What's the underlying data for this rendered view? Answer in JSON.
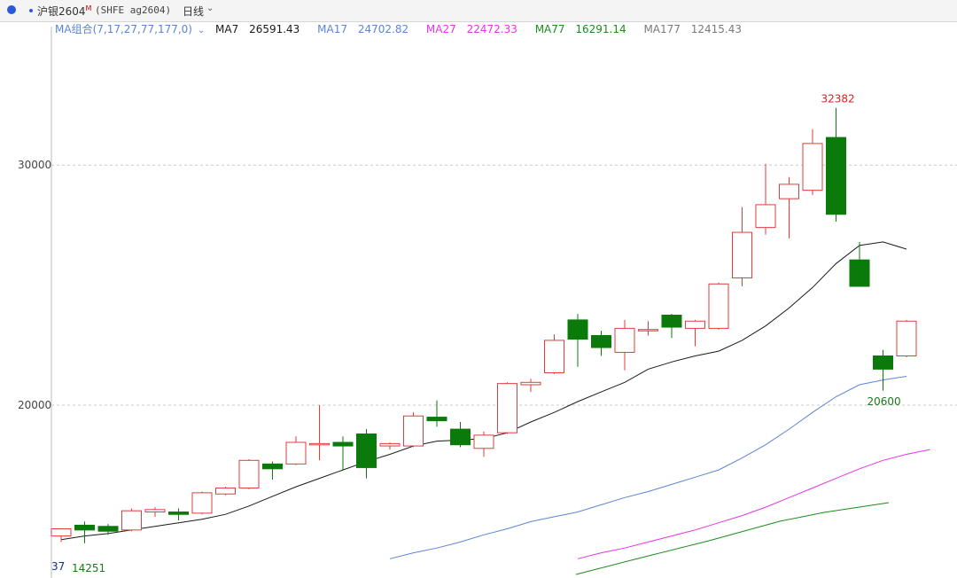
{
  "header": {
    "instrument_name": "沪银2604",
    "marker": "M",
    "contract": "(SHFE ag2604)",
    "period": "日线",
    "dropdown_icon": "chevron-down-icon"
  },
  "ma_legend": {
    "combo_label": "MA组合(7,17,27,77,177,0)",
    "items": [
      {
        "label": "MA7",
        "value": "26591.43",
        "color": "#1a1a1a"
      },
      {
        "label": "MA17",
        "value": "24702.82",
        "color": "#5b84d6"
      },
      {
        "label": "MA27",
        "value": "22472.33",
        "color": "#e633e6"
      },
      {
        "label": "MA77",
        "value": "16291.14",
        "color": "#1c8c1c"
      },
      {
        "label": "MA177",
        "value": "12415.43",
        "color": "#7a7a7a"
      }
    ]
  },
  "colors": {
    "up": "#e23b3b",
    "down": "#0a7a0a",
    "grid": "#c8c8c8"
  },
  "annotations": {
    "high_label": "32382",
    "low_label": "20600",
    "bottom_left_label": "14251",
    "bottom_left_partial": "37"
  },
  "chart_data": {
    "type": "candlestick",
    "title": "",
    "ylim": [
      12800,
      35400
    ],
    "y_ticks": [
      20000,
      30000
    ],
    "y_tick_labels": [
      "20000",
      "30000"
    ],
    "grid": true,
    "candles": [
      {
        "o": 14550,
        "h": 14700,
        "l": 14300,
        "c": 14850
      },
      {
        "o": 15000,
        "h": 15150,
        "l": 14251,
        "c": 14800
      },
      {
        "o": 14950,
        "h": 15050,
        "l": 14600,
        "c": 14750
      },
      {
        "o": 14800,
        "h": 15700,
        "l": 14750,
        "c": 15600
      },
      {
        "o": 15550,
        "h": 15750,
        "l": 15350,
        "c": 15650
      },
      {
        "o": 15550,
        "h": 15700,
        "l": 15200,
        "c": 15450
      },
      {
        "o": 15500,
        "h": 16400,
        "l": 15450,
        "c": 16350
      },
      {
        "o": 16300,
        "h": 16600,
        "l": 16250,
        "c": 16550
      },
      {
        "o": 16550,
        "h": 17750,
        "l": 16500,
        "c": 17700
      },
      {
        "o": 17550,
        "h": 17650,
        "l": 16900,
        "c": 17350
      },
      {
        "o": 17550,
        "h": 18700,
        "l": 17500,
        "c": 18450
      },
      {
        "o": 18400,
        "h": 20000,
        "l": 17700,
        "c": 18400
      },
      {
        "o": 18450,
        "h": 18700,
        "l": 17300,
        "c": 18300
      },
      {
        "o": 18800,
        "h": 19000,
        "l": 16950,
        "c": 17400
      },
      {
        "o": 18300,
        "h": 18450,
        "l": 18150,
        "c": 18400
      },
      {
        "o": 18300,
        "h": 19700,
        "l": 18250,
        "c": 19550
      },
      {
        "o": 19500,
        "h": 20200,
        "l": 19100,
        "c": 19350
      },
      {
        "o": 19000,
        "h": 19300,
        "l": 18250,
        "c": 18350
      },
      {
        "o": 18200,
        "h": 18900,
        "l": 17850,
        "c": 18750
      },
      {
        "o": 18850,
        "h": 20950,
        "l": 18800,
        "c": 20900
      },
      {
        "o": 20850,
        "h": 21100,
        "l": 20550,
        "c": 20950
      },
      {
        "o": 21350,
        "h": 22950,
        "l": 21300,
        "c": 22700
      },
      {
        "o": 23550,
        "h": 23800,
        "l": 21600,
        "c": 22750
      },
      {
        "o": 22900,
        "h": 23100,
        "l": 22050,
        "c": 22400
      },
      {
        "o": 22200,
        "h": 23550,
        "l": 21450,
        "c": 23200
      },
      {
        "o": 23100,
        "h": 23500,
        "l": 22900,
        "c": 23150
      },
      {
        "o": 23750,
        "h": 23800,
        "l": 22800,
        "c": 23250
      },
      {
        "o": 23200,
        "h": 23550,
        "l": 22450,
        "c": 23500
      },
      {
        "o": 23200,
        "h": 25100,
        "l": 23150,
        "c": 25050
      },
      {
        "o": 25300,
        "h": 28250,
        "l": 24950,
        "c": 27200
      },
      {
        "o": 27400,
        "h": 30050,
        "l": 27100,
        "c": 28350
      },
      {
        "o": 28600,
        "h": 29500,
        "l": 26950,
        "c": 29200
      },
      {
        "o": 28950,
        "h": 31500,
        "l": 28750,
        "c": 30900
      },
      {
        "o": 31150,
        "h": 32382,
        "l": 27650,
        "c": 27950
      },
      {
        "o": 26050,
        "h": 26800,
        "l": 24950,
        "c": 24950
      },
      {
        "o": 22050,
        "h": 22300,
        "l": 20600,
        "c": 21500
      },
      {
        "o": 22050,
        "h": 23550,
        "l": 22000,
        "c": 23500
      }
    ],
    "series": [
      {
        "name": "MA7",
        "values": [
          14400,
          14550,
          14650,
          14800,
          14950,
          15100,
          15250,
          15450,
          15800,
          16200,
          16600,
          16950,
          17300,
          17650,
          17950,
          18300,
          18500,
          18550,
          18600,
          18850,
          19300,
          19700,
          20150,
          20550,
          20950,
          21500,
          21800,
          22050,
          22250,
          22700,
          23300,
          24050,
          24900,
          25900,
          26650,
          26800,
          26500
        ]
      },
      {
        "name": "MA17",
        "values": [
          null,
          null,
          null,
          null,
          null,
          null,
          null,
          null,
          null,
          null,
          null,
          null,
          null,
          null,
          13600,
          13850,
          14050,
          14300,
          14600,
          14850,
          15150,
          15350,
          15550,
          15850,
          16150,
          16400,
          16700,
          17000,
          17300,
          17800,
          18350,
          19000,
          19700,
          20350,
          20850,
          21050,
          21200
        ]
      },
      {
        "name": "MA27",
        "values": [
          null,
          null,
          null,
          null,
          null,
          null,
          null,
          null,
          null,
          null,
          null,
          null,
          null,
          null,
          null,
          null,
          null,
          null,
          null,
          null,
          null,
          null,
          13600,
          13850,
          14050,
          14300,
          14550,
          14800,
          15100,
          15400,
          15750,
          16150,
          16550,
          16950,
          17350,
          17700,
          17950,
          18150
        ]
      },
      {
        "name": "MA77",
        "values": [
          null,
          null,
          null,
          null,
          null,
          null,
          null,
          null,
          null,
          null,
          null,
          null,
          null,
          null,
          null,
          null,
          null,
          null,
          null,
          null,
          null,
          null,
          null,
          null,
          null,
          null,
          null,
          null,
          null,
          null,
          null,
          null,
          null,
          null,
          null,
          null,
          null
        ]
      },
      {
        "name": "MA177",
        "values": []
      }
    ]
  }
}
